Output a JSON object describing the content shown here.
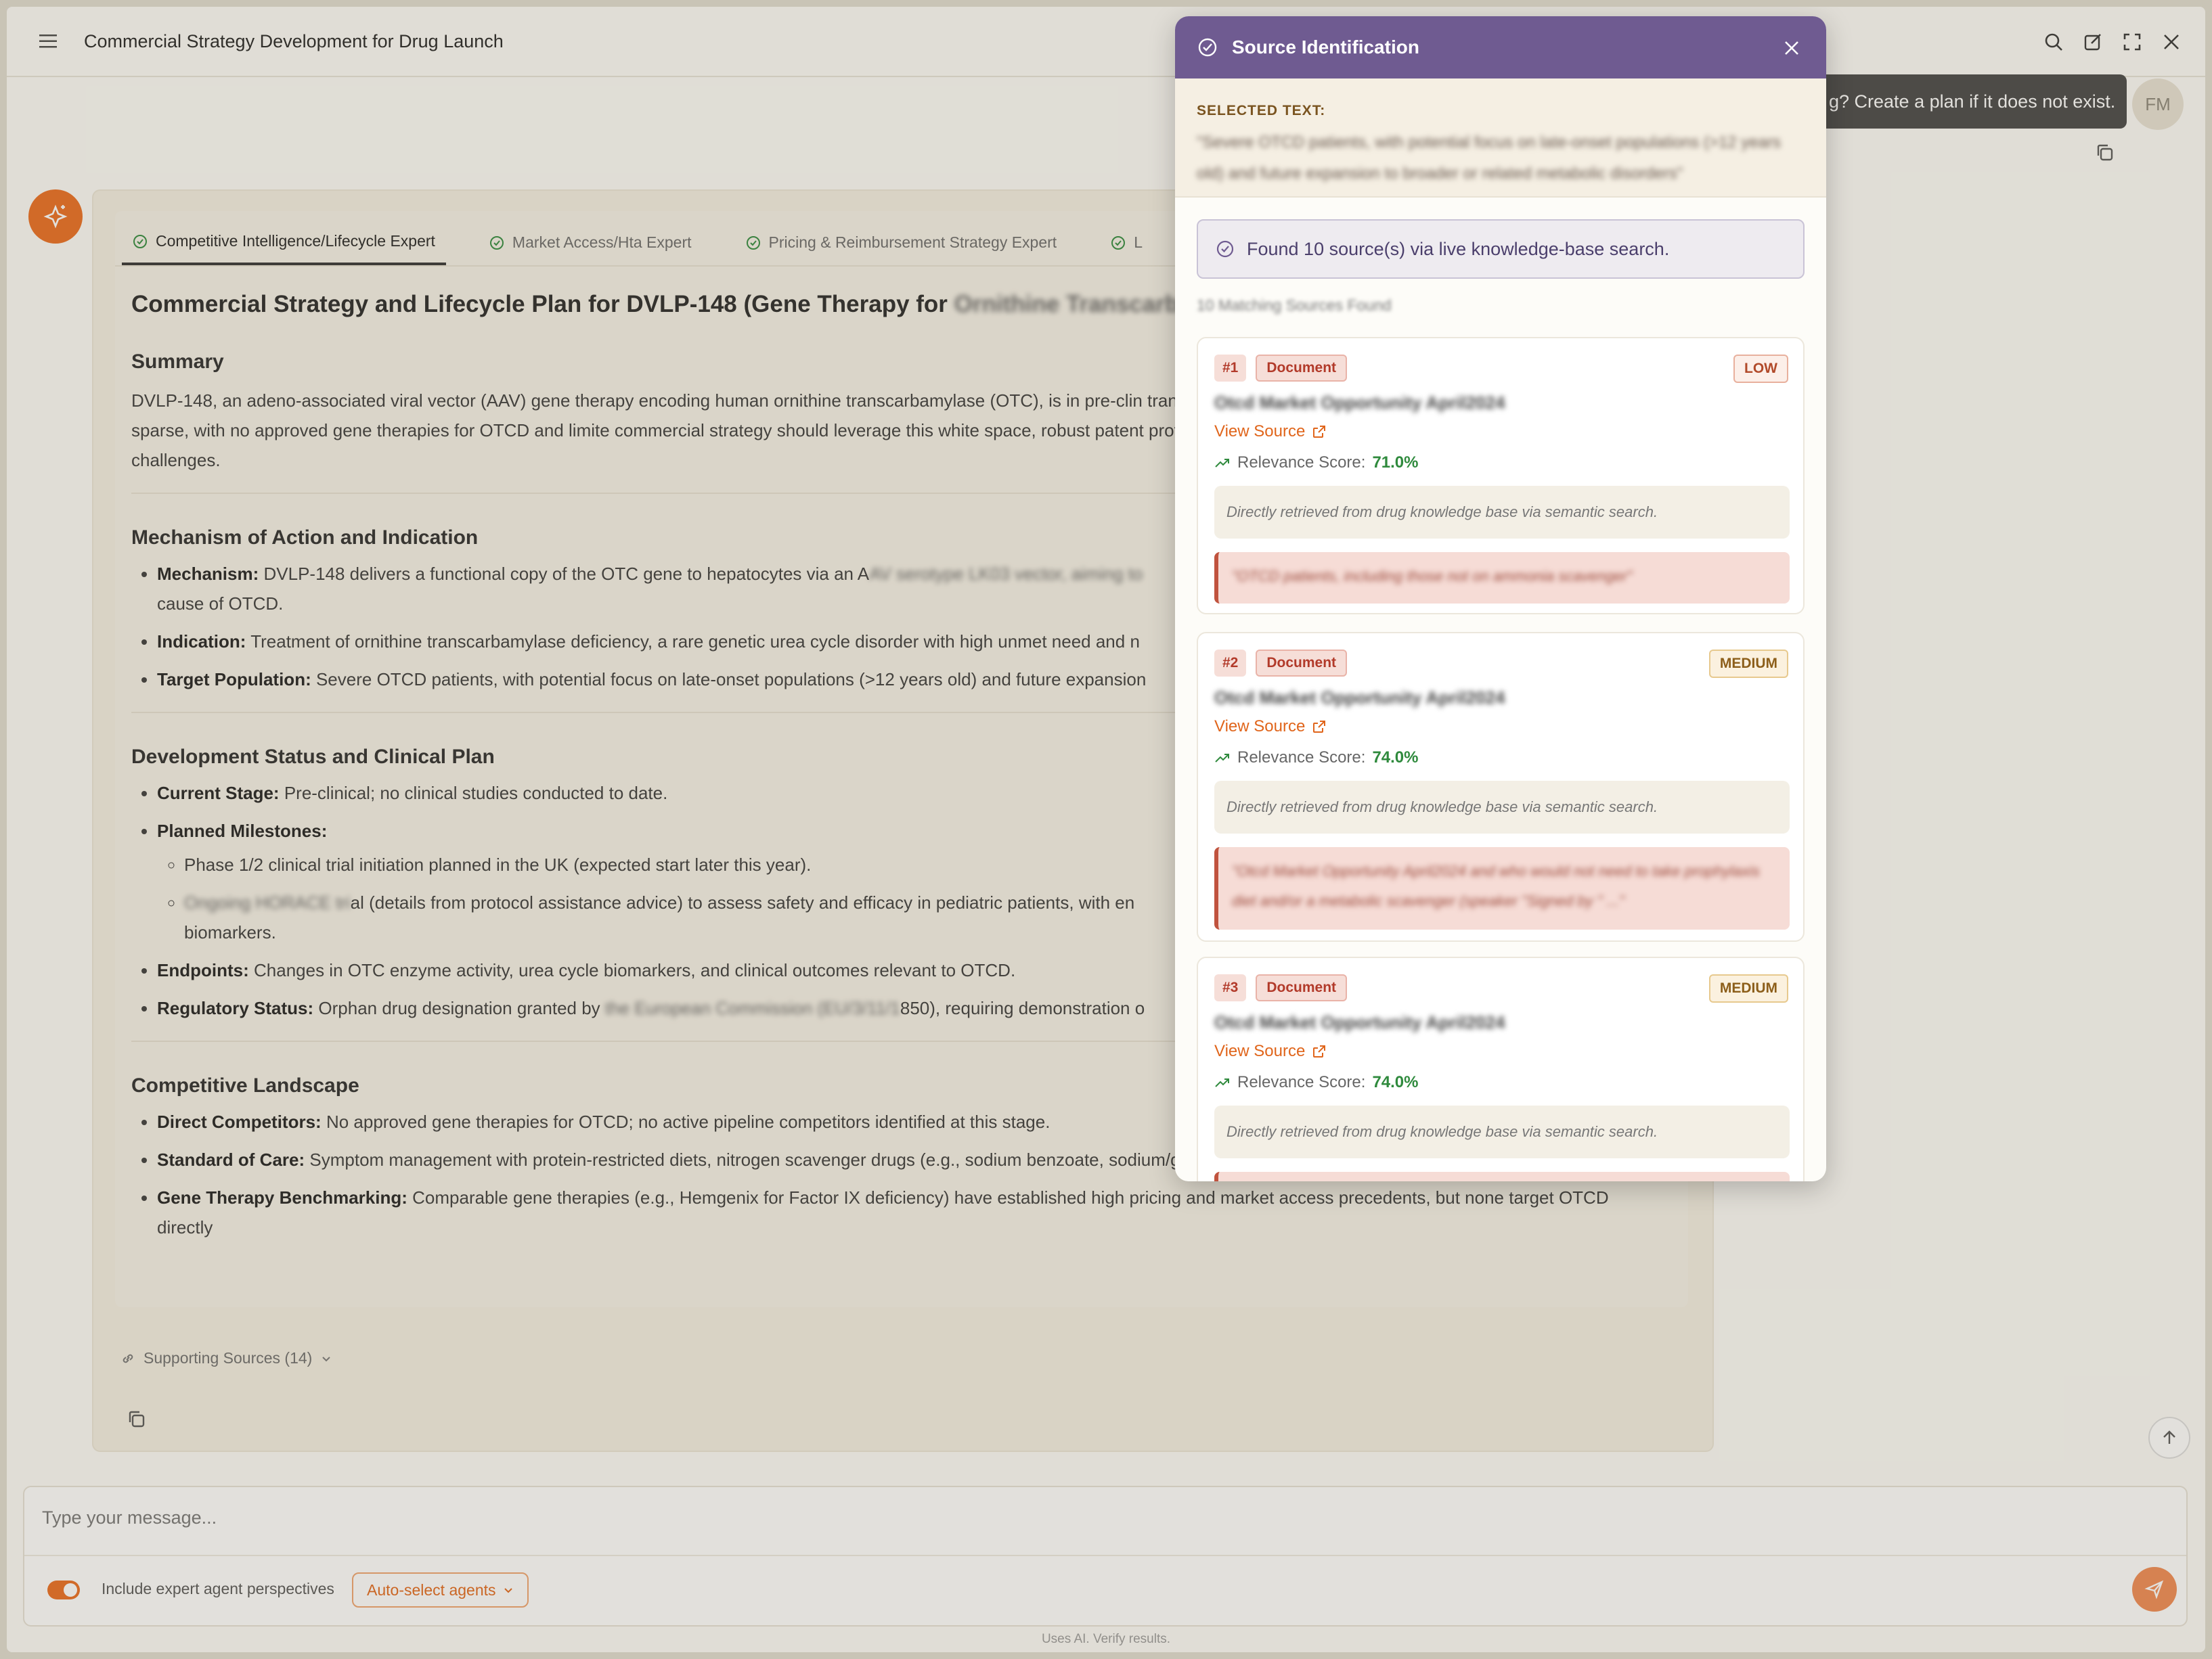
{
  "header": {
    "title": "Commercial Strategy Development for Drug Launch"
  },
  "user": {
    "message": "g? Create a plan if it does not exist.",
    "initials": "FM"
  },
  "tabs": [
    {
      "label": "Competitive Intelligence/Lifecycle Expert"
    },
    {
      "label": "Market Access/Hta Expert"
    },
    {
      "label": "Pricing & Reimbursement Strategy Expert"
    },
    {
      "label": "L"
    }
  ],
  "doc": {
    "title": "Commercial Strategy and Lifecycle Plan for DVLP-148 (Gene Therapy for",
    "title_blur": "Ornithine Transcarbamyl",
    "summary_heading": "Summary",
    "summary_text": "DVLP-148, an adeno-associated viral vector (AAV) gene therapy encoding human ornithine transcarbamylase (OTC), is in pre-clin transcarbamylase deficiency (OTCD). The competitive landscape is sparse, with no approved gene therapies for OTCD and limite commercial strategy should leverage this white space, robust patent protection, and orphan drug status to maximize value, while access challenges.",
    "moa_heading": "Mechanism of Action and Indication",
    "moa": [
      {
        "label": "Mechanism:",
        "text": "DVLP-148 delivers a functional copy of the OTC gene to hepatocytes via an A",
        "blur": "AV serotype LK03 vector, aiming to",
        "text2": "cause of OTCD."
      },
      {
        "label": "Indication:",
        "text": "Treatment of ornithine transcarbamylase deficiency, a rare genetic urea cycle disorder with high unmet need and n"
      },
      {
        "label": "Target Population:",
        "text": "Severe OTCD patients, with potential focus on late-onset populations (>12 years old) and future expansion"
      }
    ],
    "dev_heading": "Development Status and Clinical Plan",
    "current_stage_label": "Current Stage:",
    "current_stage": "Pre-clinical; no clinical studies conducted to date.",
    "milestones_label": "Planned Milestones:",
    "milestone_1": "Phase 1/2 clinical trial initiation planned in the UK (expected start later this year).",
    "milestone_2_blur": "Ongoing HORACE tri",
    "milestone_2": "al (details from protocol assistance advice) to assess safety and efficacy in pediatric patients, with en",
    "milestone_2b": "biomarkers.",
    "endpoints_label": "Endpoints:",
    "endpoints": "Changes in OTC enzyme activity, urea cycle biomarkers, and clinical outcomes relevant to OTCD.",
    "regulatory_label": "Regulatory Status:",
    "regulatory_pre": "Orphan drug designation granted by ",
    "regulatory_blur": "the European Commission (EU/3/11/1",
    "regulatory_post": "850), requiring demonstration o",
    "comp_heading": "Competitive Landscape",
    "comp": [
      {
        "label": "Direct Competitors:",
        "text": "No approved gene therapies for OTCD; no active pipeline competitors identified at this stage."
      },
      {
        "label": "Standard of Care:",
        "text": "Symptom management with protein-restricted diets, nitrogen scavenger drugs (e.g., sodium benzoate, sodium/glycerol phenylbutyrate), and L-arginine supplementation."
      },
      {
        "label": "Gene Therapy Benchmarking:",
        "text": "Comparable gene therapies (e.g., Hemgenix for Factor IX deficiency) have established high pricing and market access precedents, but none target OTCD"
      }
    ],
    "cut_text": "directly"
  },
  "supporting": {
    "label": "Supporting Sources (14)"
  },
  "composer": {
    "placeholder": "Type your message...",
    "toggle_label": "Include expert agent perspectives",
    "agent_button": "Auto-select agents",
    "footer": "Uses AI. Verify results."
  },
  "panel": {
    "title": "Source Identification",
    "selected_label": "SELECTED TEXT:",
    "selected_text": "\"Severe OTCD patients, with potential focus on late-onset populations (>12 years old) and future expansion to broader or related metabolic disorders\"",
    "found_text": "Found 10 source(s) via live knowledge-base search.",
    "matching_note": "10 Matching Sources Found",
    "sources": [
      {
        "num": "#1",
        "type": "Document",
        "level": "LOW",
        "name": "Otcd Market Opportunity April2024",
        "view": "View Source",
        "relevance_label": "Relevance Score:",
        "relevance": "71.0%",
        "note": "Directly retrieved from drug knowledge base via semantic search.",
        "quote": "\"OTCD patients, including those not on ammonia scavenger\""
      },
      {
        "num": "#2",
        "type": "Document",
        "level": "MEDIUM",
        "name": "Otcd Market Opportunity April2024",
        "view": "View Source",
        "relevance_label": "Relevance Score:",
        "relevance": "74.0%",
        "note": "Directly retrieved from drug knowledge base via semantic search.",
        "quote": "\"Otcd Market Opportunity April2024 and who would not need to take prophylaxis diet and/or a metabolic scavenger (speaker \"Signed by \" ...\""
      },
      {
        "num": "#3",
        "type": "Document",
        "level": "MEDIUM",
        "name": "Otcd Market Opportunity April2024",
        "view": "View Source",
        "relevance_label": "Relevance Score:",
        "relevance": "74.0%",
        "note": "Directly retrieved from drug knowledge base via semantic search.",
        "quote": ""
      }
    ]
  },
  "colors": {
    "accent": "#ea6c1f",
    "panel_header": "#6f5b91",
    "relevance": "#2f8a3d"
  }
}
